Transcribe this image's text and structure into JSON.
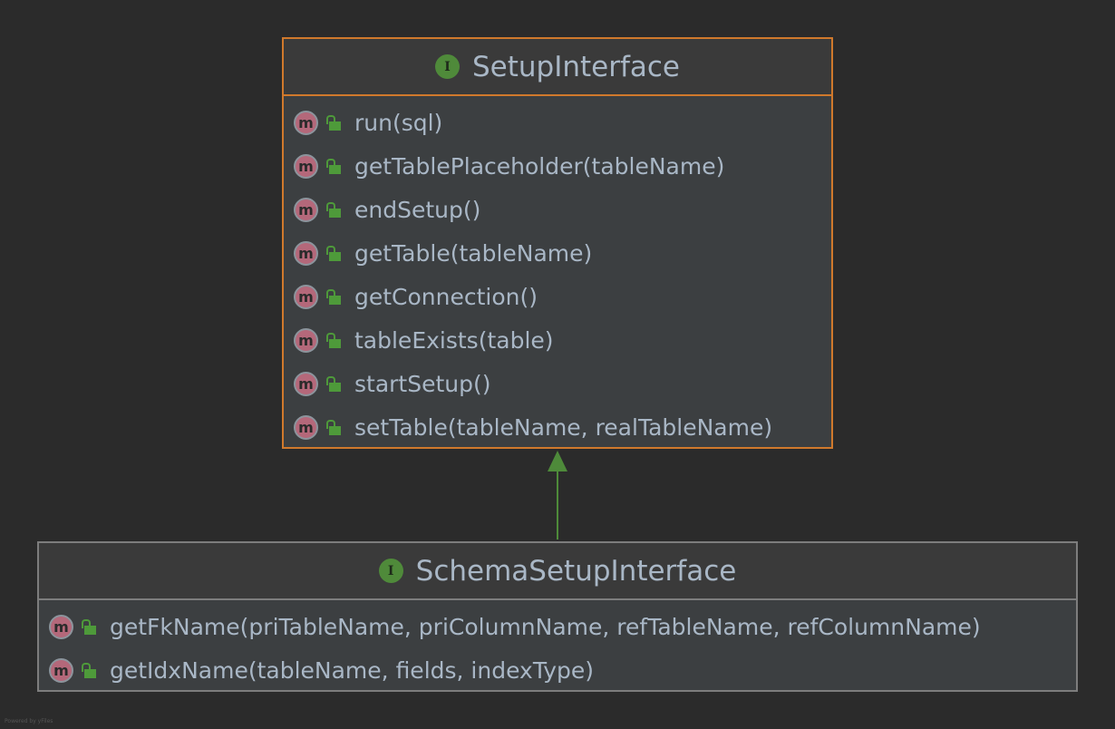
{
  "colors": {
    "background": "#2b2b2b",
    "node_fill": "#3c3f41",
    "selected_border": "#d0792c",
    "border": "#7d7d7d",
    "text": "#a9b7c6",
    "interface_badge": "#4f8a3a",
    "method_badge": "#b4687a",
    "inheritance_arrow": "#4e8a3a"
  },
  "nodes": [
    {
      "title": "SetupInterface",
      "badge": "I",
      "methods": [
        {
          "badge": "m",
          "name": "run(sql)"
        },
        {
          "badge": "m",
          "name": "getTablePlaceholder(tableName)"
        },
        {
          "badge": "m",
          "name": "endSetup()"
        },
        {
          "badge": "m",
          "name": "getTable(tableName)"
        },
        {
          "badge": "m",
          "name": "getConnection()"
        },
        {
          "badge": "m",
          "name": "tableExists(table)"
        },
        {
          "badge": "m",
          "name": "startSetup()"
        },
        {
          "badge": "m",
          "name": "setTable(tableName, realTableName)"
        }
      ]
    },
    {
      "title": "SchemaSetupInterface",
      "badge": "I",
      "methods": [
        {
          "badge": "m",
          "name": "getFkName(priTableName, priColumnName, refTableName, refColumnName)"
        },
        {
          "badge": "m",
          "name": "getIdxName(tableName, fields, indexType)"
        }
      ]
    }
  ],
  "edges": [
    {
      "from": "SchemaSetupInterface",
      "to": "SetupInterface",
      "type": "extends"
    }
  ],
  "footer": "Powered by yFiles"
}
